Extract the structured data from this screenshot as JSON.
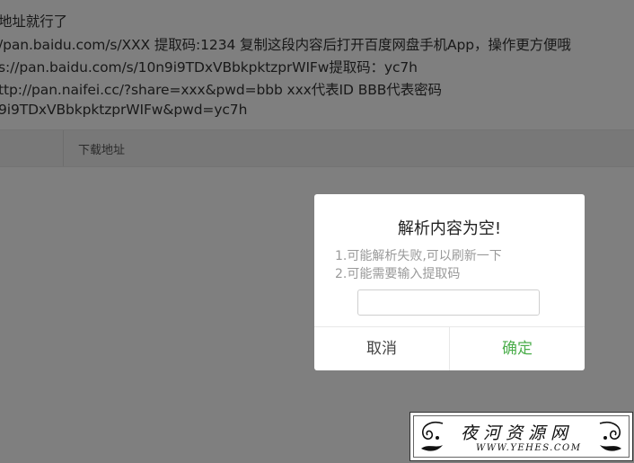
{
  "instructions": {
    "lines": [
      "地址就行了",
      "/pan.baidu.com/s/XXX 提取码:1234 复制这段内容后打开百度网盘手机App，操作更方便哦",
      "s://pan.baidu.com/s/10n9i9TDxVBbkpktzprWIFw提取码：yc7h",
      "ttp://pan.naifei.cc/?share=xxx&pwd=bbb xxx代表ID BBB代表密码",
      "9i9TDxVBbkpktzprWIFw&pwd=yc7h"
    ]
  },
  "tabs": {
    "download_label": "下载地址"
  },
  "dialog": {
    "title": "解析内容为空!",
    "messages": [
      "1.可能解析失败,可以刷新一下",
      "2.可能需要输入提取码"
    ],
    "input_value": "",
    "cancel_label": "取消",
    "confirm_label": "确定",
    "confirm_color": "#4cae4c"
  },
  "watermark": {
    "title": "夜河资源网",
    "url": "WWW.YEHES.COM"
  }
}
